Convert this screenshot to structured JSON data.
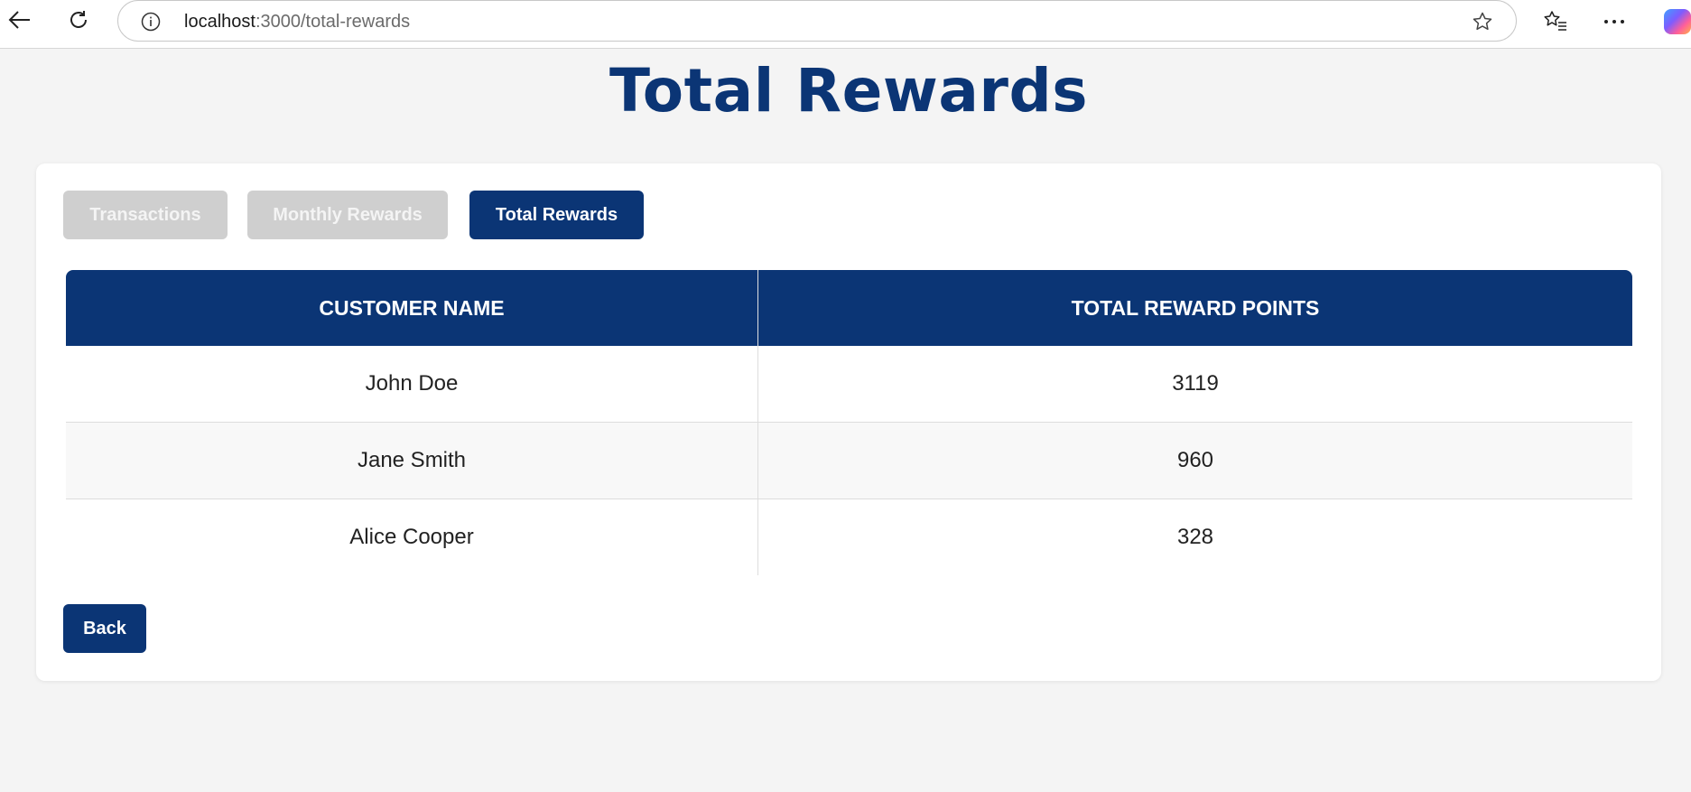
{
  "browser": {
    "url_host": "localhost",
    "url_path": ":3000/total-rewards",
    "icons": [
      "back-arrow-icon",
      "refresh-icon",
      "info-icon",
      "star-icon",
      "favorites-icon",
      "more-icon",
      "copilot-icon"
    ]
  },
  "page": {
    "title": "Total Rewards"
  },
  "tabs": [
    {
      "label": "Transactions",
      "active": false
    },
    {
      "label": "Monthly Rewards",
      "active": false
    },
    {
      "label": "Total Rewards",
      "active": true
    }
  ],
  "table": {
    "headers": [
      "CUSTOMER NAME",
      "TOTAL REWARD POINTS"
    ],
    "rows": [
      [
        "John Doe",
        "3119"
      ],
      [
        "Jane Smith",
        "960"
      ],
      [
        "Alice Cooper",
        "328"
      ]
    ]
  },
  "actions": {
    "back_label": "Back"
  },
  "colors": {
    "primary": "#0b3575",
    "inactive_tab": "#cfcfcf",
    "background": "#f4f4f4"
  }
}
